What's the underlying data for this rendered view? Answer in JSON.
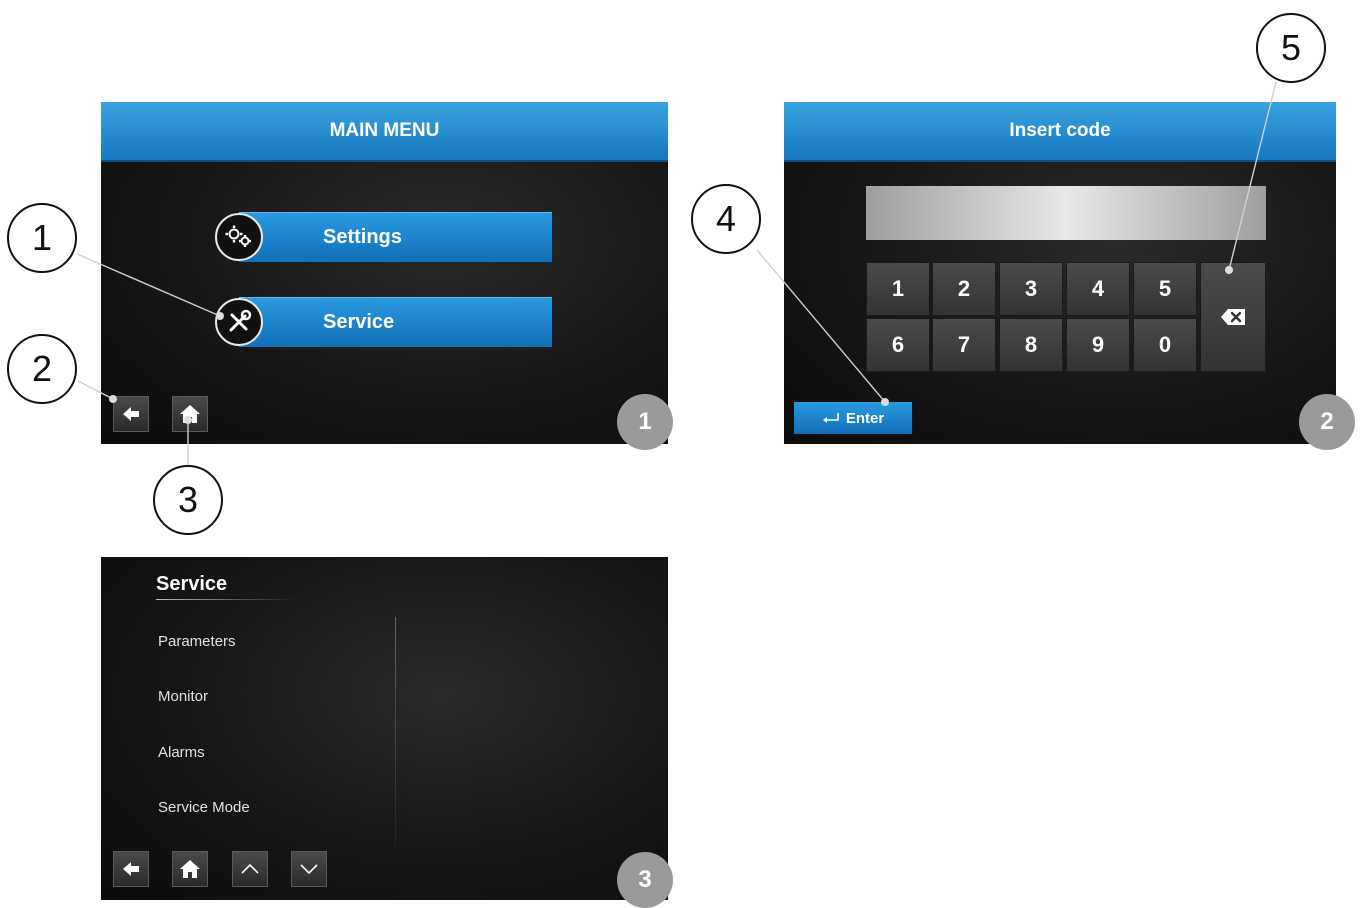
{
  "screen1": {
    "title": "MAIN MENU",
    "menu": [
      {
        "label": "Settings",
        "icon": "gears-icon"
      },
      {
        "label": "Service",
        "icon": "wrench-screwdriver-icon"
      }
    ],
    "badge": "1"
  },
  "screen2": {
    "title": "Insert code",
    "keys_row1": [
      "1",
      "2",
      "3",
      "4",
      "5"
    ],
    "keys_row2": [
      "6",
      "7",
      "8",
      "9",
      "0"
    ],
    "enter_label": "Enter",
    "badge": "2"
  },
  "screen3": {
    "title": "Service",
    "items": [
      "Parameters",
      "Monitor",
      "Alarms",
      "Service Mode"
    ],
    "badge": "3"
  },
  "callouts": [
    "1",
    "2",
    "3",
    "4",
    "5"
  ],
  "colors": {
    "accent_blue": "#1e88d0",
    "badge_gray": "#9a9a9a",
    "screen_bg": "#161616"
  }
}
